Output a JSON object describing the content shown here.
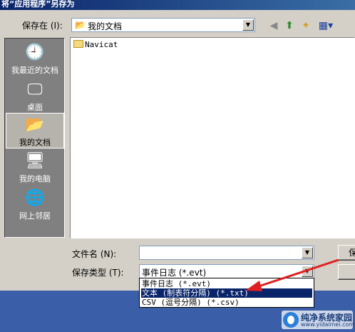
{
  "window": {
    "title": "将“应用程序”另存为"
  },
  "save_in": {
    "label": "保存在 (I):",
    "value": "我的文档"
  },
  "places": [
    {
      "label": "我最近的文档",
      "icon": "recent-documents-icon"
    },
    {
      "label": "桌面",
      "icon": "desktop-icon"
    },
    {
      "label": "我的文档",
      "icon": "my-documents-icon"
    },
    {
      "label": "我的电脑",
      "icon": "my-computer-icon"
    },
    {
      "label": "网上邻居",
      "icon": "network-places-icon"
    }
  ],
  "files": [
    {
      "name": "Navicat",
      "icon": "folder-icon"
    }
  ],
  "filename": {
    "label": "文件名 (N):",
    "value": ""
  },
  "filetype": {
    "label": "保存类型 (T):",
    "value": "事件日志 (*.evt)",
    "options": [
      "事件日志 (*.evt)",
      "文本 (制表符分隔) (*.txt)",
      "CSV (逗号分隔) (*.csv)"
    ],
    "highlighted_index": 1
  },
  "buttons": {
    "save": "保",
    "cancel": ""
  },
  "watermark": {
    "text": "纯净系统家园",
    "url": "www.yidaimei.com"
  },
  "colors": {
    "title_bar": "#0a246a",
    "highlight": "#0a246a",
    "annotation_arrow": "#e02020",
    "taskbar": "#3b5ea8"
  }
}
